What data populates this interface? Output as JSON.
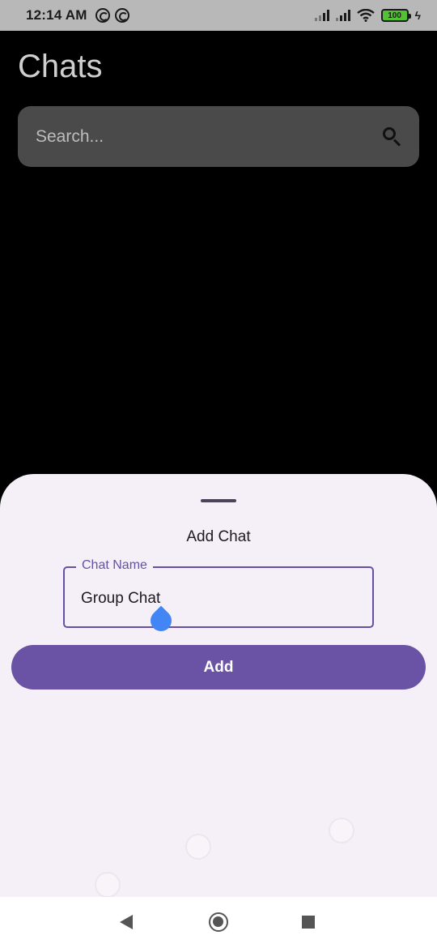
{
  "status_bar": {
    "time": "12:14 AM",
    "battery": "100",
    "icons": [
      "sync-icon",
      "sync-icon",
      "signal-icon",
      "signal-icon",
      "wifi-icon",
      "battery-icon",
      "charging-icon"
    ]
  },
  "header": {
    "title": "Chats"
  },
  "search": {
    "placeholder": "Search..."
  },
  "sheet": {
    "title": "Add Chat",
    "field_label": "Chat Name",
    "field_value": "Group Chat",
    "add_label": "Add"
  },
  "nav_bar": {
    "icons": [
      "back-icon",
      "home-icon",
      "recents-icon"
    ]
  },
  "colors": {
    "accent": "#6750a4",
    "button": "#6a52a5",
    "sheet_bg": "#f5f0f8",
    "search_bg": "#4a4a4a",
    "cursor": "#4285f4"
  }
}
